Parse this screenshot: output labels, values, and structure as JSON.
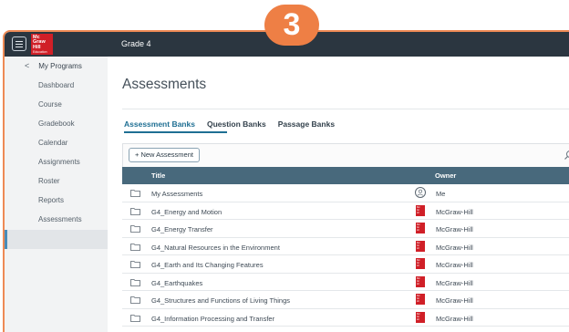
{
  "badge": "3",
  "header": {
    "grade": "Grade 4",
    "logo_lines": [
      "Mc",
      "Graw",
      "Hill",
      "Education"
    ]
  },
  "sidebar": {
    "back_label": "My Programs",
    "items": [
      {
        "label": "Dashboard"
      },
      {
        "label": "Course"
      },
      {
        "label": "Gradebook"
      },
      {
        "label": "Calendar"
      },
      {
        "label": "Assignments"
      },
      {
        "label": "Roster"
      },
      {
        "label": "Reports"
      },
      {
        "label": "Assessments",
        "active": true
      }
    ]
  },
  "main": {
    "title": "Assessments",
    "tabs": [
      {
        "label": "Assessment Banks",
        "active": true
      },
      {
        "label": "Question Banks"
      },
      {
        "label": "Passage Banks"
      }
    ],
    "new_button": "+ New Assessment",
    "columns": {
      "title": "Title",
      "owner": "Owner"
    },
    "rows": [
      {
        "title": "My Assessments",
        "owner": "Me",
        "owner_icon": "user-icon"
      },
      {
        "title": "G4_Energy and Motion",
        "owner": "McGraw-Hill",
        "owner_icon": "mcgraw-hill-logo-icon"
      },
      {
        "title": "G4_Energy Transfer",
        "owner": "McGraw-Hill",
        "owner_icon": "mcgraw-hill-logo-icon"
      },
      {
        "title": "G4_Natural Resources in the Environment",
        "owner": "McGraw-Hill",
        "owner_icon": "mcgraw-hill-logo-icon"
      },
      {
        "title": "G4_Earth and Its Changing Features",
        "owner": "McGraw-Hill",
        "owner_icon": "mcgraw-hill-logo-icon"
      },
      {
        "title": "G4_Earthquakes",
        "owner": "McGraw-Hill",
        "owner_icon": "mcgraw-hill-logo-icon"
      },
      {
        "title": "G4_Structures and Functions of Living Things",
        "owner": "McGraw-Hill",
        "owner_icon": "mcgraw-hill-logo-icon"
      },
      {
        "title": "G4_Information Processing and Transfer",
        "owner": "McGraw-Hill",
        "owner_icon": "mcgraw-hill-logo-icon"
      }
    ]
  },
  "colors": {
    "accent": "#ee7f45",
    "topbar": "#2b3640",
    "table_header": "#48697c",
    "link": "#1f6f93",
    "brand": "#d01f27"
  }
}
